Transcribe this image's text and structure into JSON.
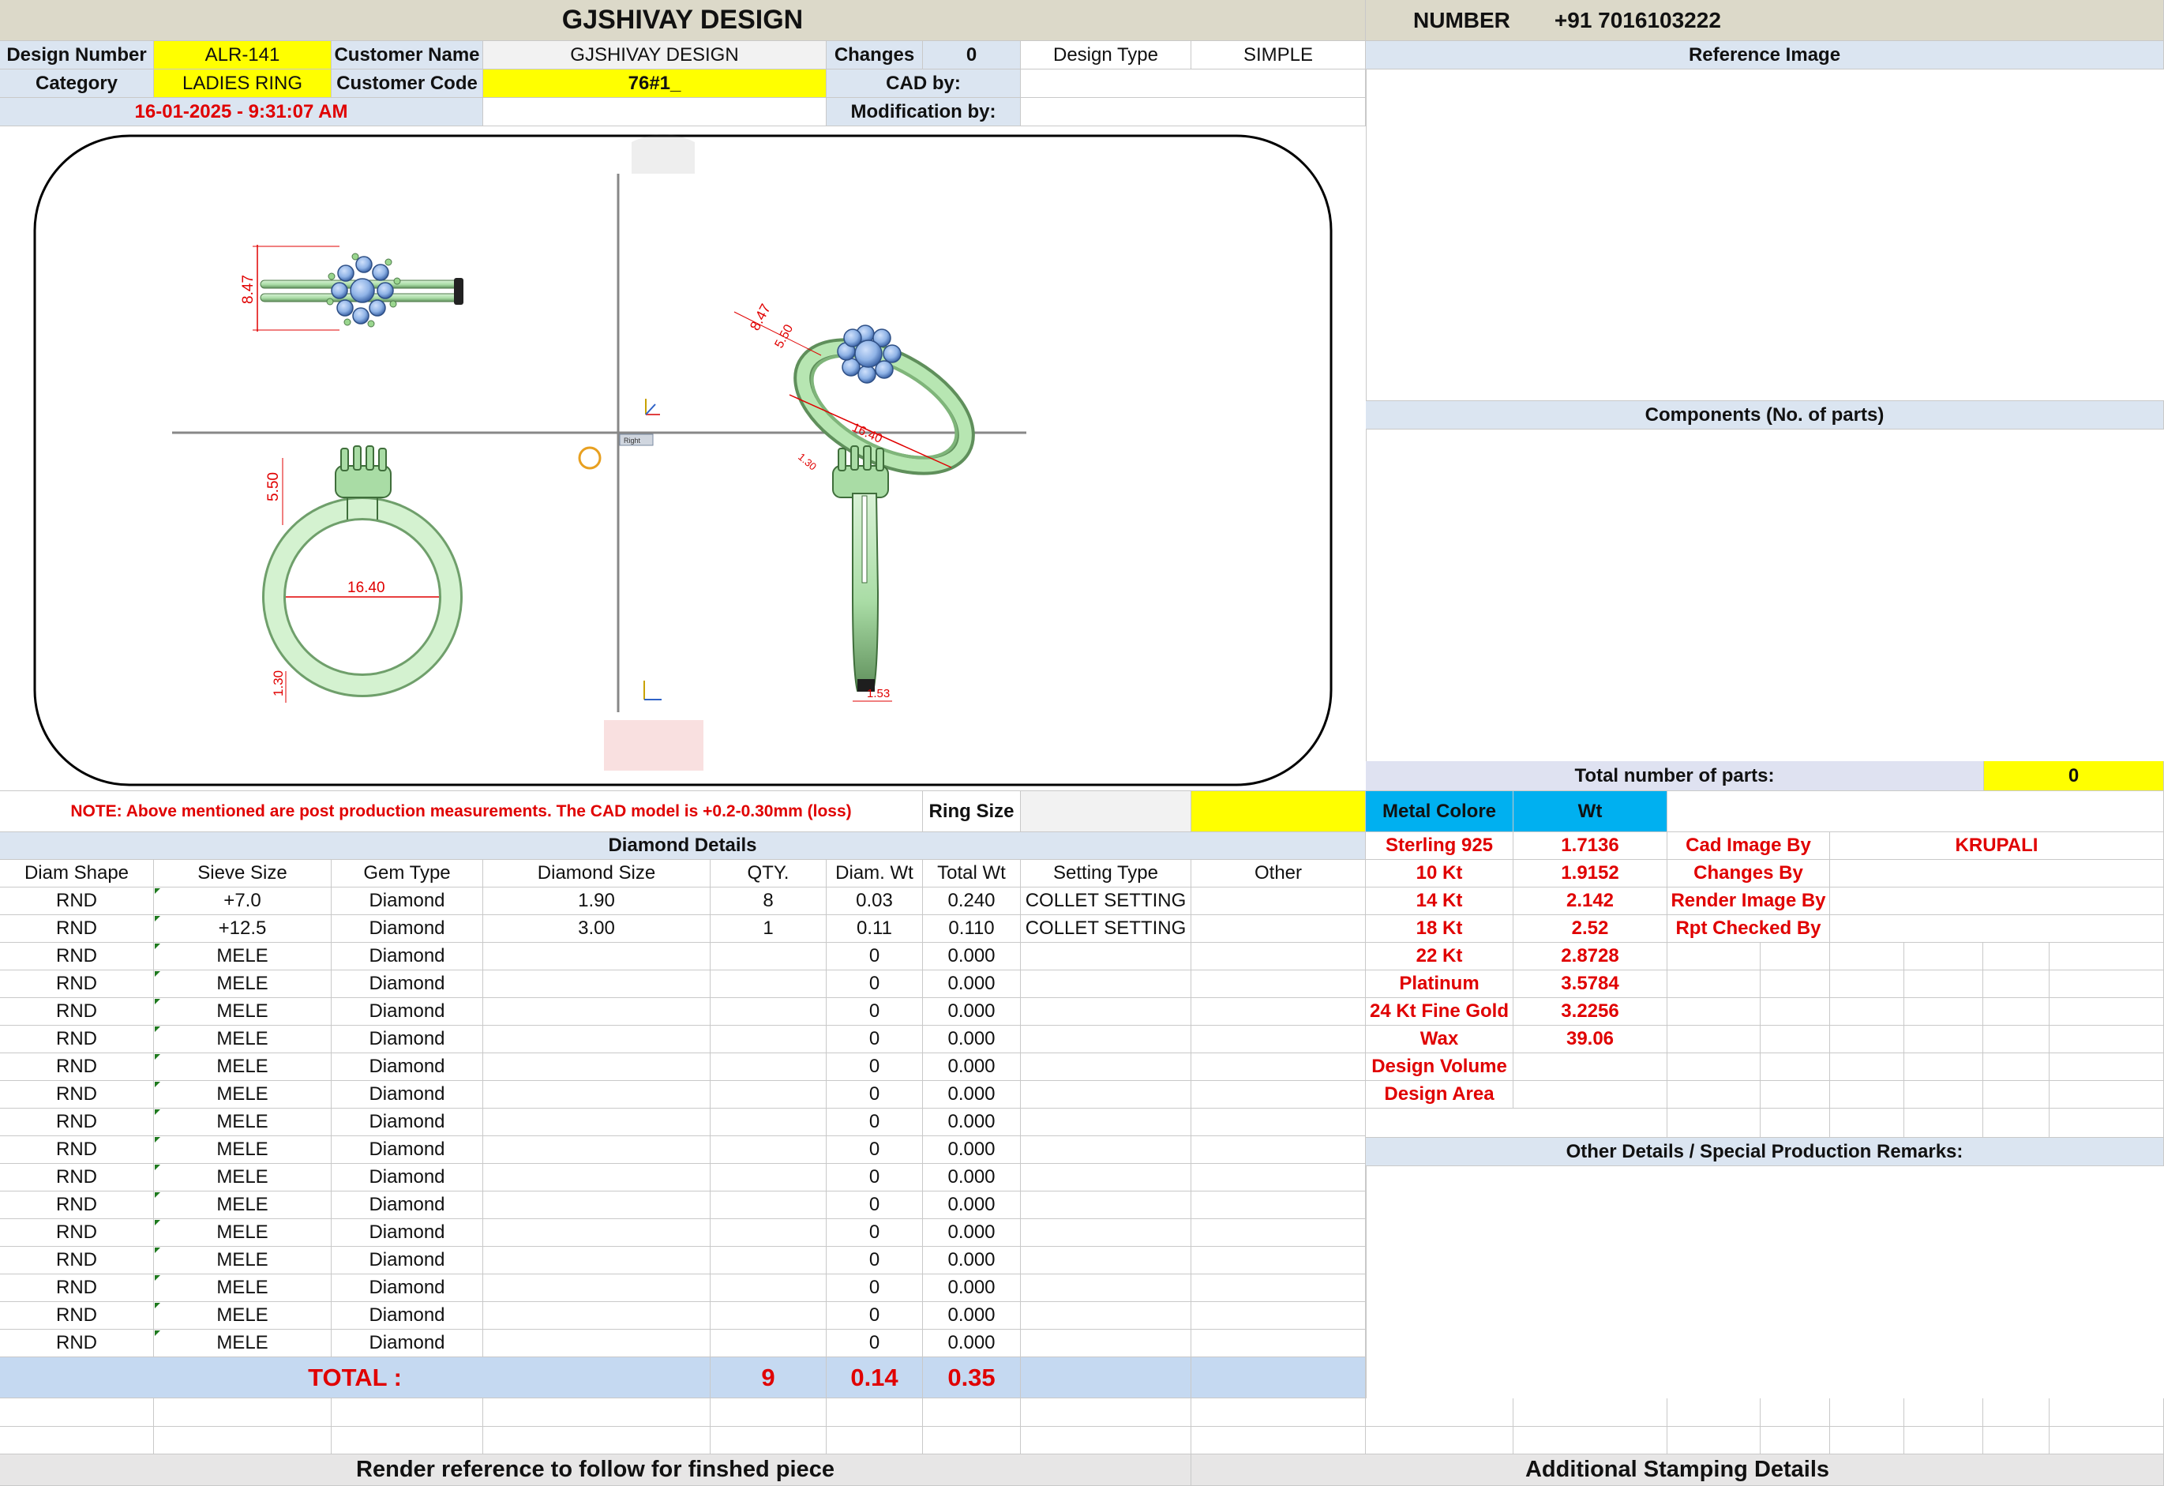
{
  "title": "GJSHIVAY DESIGN",
  "contact": {
    "label": "NUMBER",
    "value": "+91 7016103222"
  },
  "meta": {
    "design_number_label": "Design Number",
    "design_number": "ALR-141",
    "customer_name_label": "Customer Name",
    "customer_name": "GJSHIVAY DESIGN",
    "changes_label": "Changes",
    "changes": "0",
    "design_type_label": "Design Type",
    "design_type": "SIMPLE",
    "category_label": "Category",
    "category": "LADIES RING",
    "customer_code_label": "Customer Code",
    "customer_code": "76#1_",
    "cad_by_label": "CAD by:",
    "cad_by": "",
    "date": "16-01-2025 - 9:31:07 AM",
    "modification_by_label": "Modification by:",
    "modification_by": ""
  },
  "drawing": {
    "dims": {
      "top_height": "8.47",
      "iso_a": "8.47",
      "iso_b": "5.50",
      "iso_c": "16.40",
      "iso_d": "1.30",
      "front_head": "5.50",
      "front_dia": "16.40",
      "front_band": "1.30",
      "side_width": "1.53"
    },
    "view_tag": "Right",
    "colors": {
      "metal": "#a9dca5",
      "metal_dark": "#6f9f6b",
      "stone": "#8fb3e6",
      "stone_dark": "#3d65a8",
      "dim": "#e00000"
    }
  },
  "note": "NOTE: Above mentioned are post production measurements. The CAD model is +0.2-0.30mm (loss)",
  "ring_size_label": "Ring Size",
  "ring_size": "",
  "diamond": {
    "section_title": "Diamond Details",
    "headers": [
      "Diam Shape",
      "Sieve Size",
      "Gem Type",
      "Diamond Size",
      "QTY.",
      "Diam. Wt",
      "Total Wt",
      "Setting Type",
      "Other"
    ],
    "rows": [
      [
        "RND",
        "+7.0",
        "Diamond",
        "1.90",
        "8",
        "0.03",
        "0.240",
        "COLLET SETTING",
        ""
      ],
      [
        "RND",
        "+12.5",
        "Diamond",
        "3.00",
        "1",
        "0.11",
        "0.110",
        "COLLET SETTING",
        ""
      ],
      [
        "RND",
        "MELE",
        "Diamond",
        "",
        "",
        "0",
        "0.000",
        "",
        ""
      ],
      [
        "RND",
        "MELE",
        "Diamond",
        "",
        "",
        "0",
        "0.000",
        "",
        ""
      ],
      [
        "RND",
        "MELE",
        "Diamond",
        "",
        "",
        "0",
        "0.000",
        "",
        ""
      ],
      [
        "RND",
        "MELE",
        "Diamond",
        "",
        "",
        "0",
        "0.000",
        "",
        ""
      ],
      [
        "RND",
        "MELE",
        "Diamond",
        "",
        "",
        "0",
        "0.000",
        "",
        ""
      ],
      [
        "RND",
        "MELE",
        "Diamond",
        "",
        "",
        "0",
        "0.000",
        "",
        ""
      ],
      [
        "RND",
        "MELE",
        "Diamond",
        "",
        "",
        "0",
        "0.000",
        "",
        ""
      ],
      [
        "RND",
        "MELE",
        "Diamond",
        "",
        "",
        "0",
        "0.000",
        "",
        ""
      ],
      [
        "RND",
        "MELE",
        "Diamond",
        "",
        "",
        "0",
        "0.000",
        "",
        ""
      ],
      [
        "RND",
        "MELE",
        "Diamond",
        "",
        "",
        "0",
        "0.000",
        "",
        ""
      ],
      [
        "RND",
        "MELE",
        "Diamond",
        "",
        "",
        "0",
        "0.000",
        "",
        ""
      ],
      [
        "RND",
        "MELE",
        "Diamond",
        "",
        "",
        "0",
        "0.000",
        "",
        ""
      ],
      [
        "RND",
        "MELE",
        "Diamond",
        "",
        "",
        "0",
        "0.000",
        "",
        ""
      ],
      [
        "RND",
        "MELE",
        "Diamond",
        "",
        "",
        "0",
        "0.000",
        "",
        ""
      ],
      [
        "RND",
        "MELE",
        "Diamond",
        "",
        "",
        "0",
        "0.000",
        "",
        ""
      ]
    ],
    "total_label": "TOTAL :",
    "total_qty": "9",
    "total_diam_wt": "0.14",
    "total_wt": "0.35"
  },
  "reference_image_title": "Reference Image",
  "components_title": "Components (No. of parts)",
  "total_parts_label": "Total number of parts:",
  "total_parts": "0",
  "metal": {
    "color_label": "Metal Colore",
    "wt_label": "Wt",
    "rows": [
      [
        "Sterling 925",
        "1.7136"
      ],
      [
        "10 Kt",
        "1.9152"
      ],
      [
        "14 Kt",
        "2.142"
      ],
      [
        "18 Kt",
        "2.52"
      ],
      [
        "22 Kt",
        "2.8728"
      ],
      [
        "Platinum",
        "3.5784"
      ],
      [
        "24 Kt Fine Gold",
        "3.2256"
      ],
      [
        "Wax",
        "39.06"
      ],
      [
        "Design Volume",
        ""
      ],
      [
        "Design Area",
        ""
      ]
    ]
  },
  "credits": [
    {
      "label": "Cad Image By",
      "value": "KRUPALI"
    },
    {
      "label": "Changes By",
      "value": ""
    },
    {
      "label": "Render Image By",
      "value": ""
    },
    {
      "label": "Rpt Checked By",
      "value": ""
    }
  ],
  "other_details_title": "Other Details / Special Production Remarks:",
  "footer_left": "Render reference to follow for finshed piece",
  "footer_right": "Additional Stamping Details"
}
